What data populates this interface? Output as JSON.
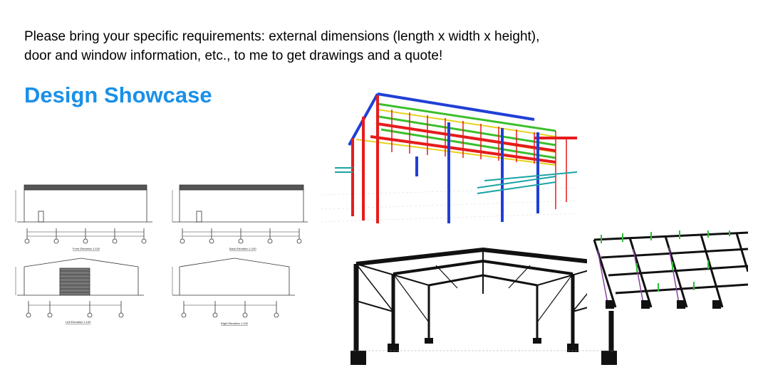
{
  "intro": {
    "line1": "Please bring your specific requirements: external dimensions (length x width x height),",
    "line2": "door and window information, etc., to me to get drawings and a quote!"
  },
  "showcase": {
    "title": "Design Showcase",
    "elevations": [
      {
        "label": "Front Elevation 1:100"
      },
      {
        "label": "Back Elevation 1:100"
      },
      {
        "label": "Left Elevation 1:100"
      },
      {
        "label": "Right Elevation 1:100"
      }
    ]
  },
  "colors": {
    "title": "#1a90e8",
    "frame_red": "#e51c1c",
    "frame_blue": "#1f3fd6",
    "frame_green": "#3bbf2b",
    "frame_yellow": "#e6d21e",
    "steel_black": "#111111"
  }
}
